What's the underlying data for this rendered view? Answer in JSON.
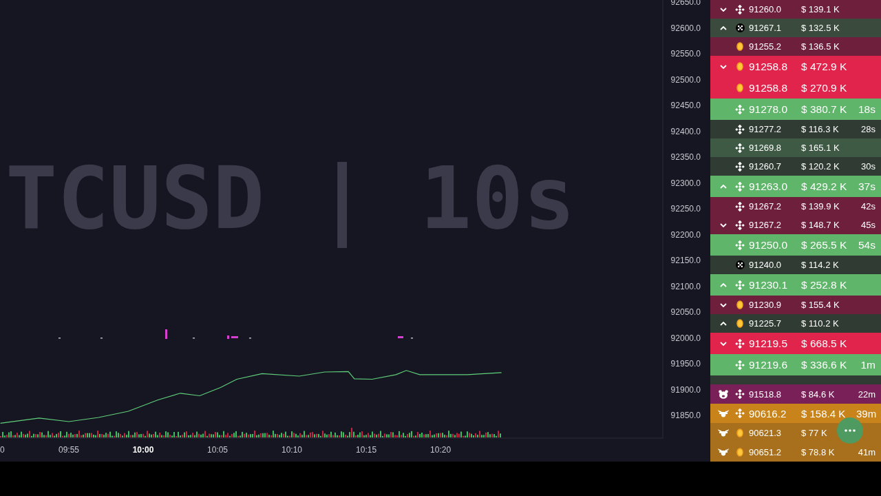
{
  "chart": {
    "watermark": "TCUSD | 10s",
    "cut_time_label": "0",
    "chart_data": {
      "type": "line",
      "x": [
        590.4,
        593,
        595,
        597,
        599,
        601,
        602.5,
        603.8,
        605.2,
        606.3,
        608,
        610.5,
        612.2,
        613.8,
        614.2,
        615.4,
        617,
        617.7,
        618.6,
        621.8,
        624.1
      ],
      "series": [
        {
          "color": "#5fd17a",
          "values": [
            91835,
            91845,
            91838,
            91846,
            91858,
            91880,
            91893,
            91888,
            91904,
            91920,
            91931,
            91926,
            91934,
            91935,
            91921,
            91920,
            91929,
            91937,
            91929,
            91929,
            91933
          ]
        }
      ],
      "xlim": [
        590.37,
        634.95
      ],
      "ylim": [
        91806,
        92654
      ],
      "xticks": [
        {
          "value": 595,
          "label": "09:55"
        },
        {
          "value": 600,
          "label": "10:00"
        },
        {
          "value": 605,
          "label": "10:05"
        },
        {
          "value": 610,
          "label": "10:10"
        },
        {
          "value": 615,
          "label": "10:15"
        },
        {
          "value": 620,
          "label": "10:20"
        }
      ],
      "yticks": [
        {
          "value": 92650,
          "label": "92650.0"
        },
        {
          "value": 92600,
          "label": "92600.0"
        },
        {
          "value": 92550,
          "label": "92550.0"
        },
        {
          "value": 92500,
          "label": "92500.0"
        },
        {
          "value": 92450,
          "label": "92450.0"
        },
        {
          "value": 92400,
          "label": "92400.0"
        },
        {
          "value": 92350,
          "label": "92350.0"
        },
        {
          "value": 92300,
          "label": "92300.0"
        },
        {
          "value": 92250,
          "label": "92250.0"
        },
        {
          "value": 92200,
          "label": "92200.0"
        },
        {
          "value": 92150,
          "label": "92150.0"
        },
        {
          "value": 92100,
          "label": "92100.0"
        },
        {
          "value": 92050,
          "label": "92050.0"
        },
        {
          "value": 92000,
          "label": "92000.0"
        },
        {
          "value": 91950,
          "label": "91950.0"
        },
        {
          "value": 91900,
          "label": "91900.0"
        },
        {
          "value": 91850,
          "label": "91850.0"
        }
      ]
    }
  },
  "trades": [
    {
      "up": false,
      "down": true,
      "kind": "diamond",
      "price": "91260.0",
      "amount": "$ 139.1 K",
      "color": "#6e1f3c",
      "large": false
    },
    {
      "up": true,
      "down": false,
      "kind": "cross",
      "price": "91267.1",
      "amount": "$ 132.5 K",
      "color": "#3a4a3c",
      "large": false
    },
    {
      "up": false,
      "down": false,
      "kind": "coin",
      "price": "91255.2",
      "amount": "$ 136.5 K",
      "color": "#6e1f3c",
      "large": false
    },
    {
      "up": false,
      "down": true,
      "kind": "coin",
      "price": "91258.8",
      "amount": "$ 472.9 K",
      "color": "#e0244c",
      "large": true
    },
    {
      "up": false,
      "down": false,
      "kind": "coin",
      "price": "91258.8",
      "amount": "$ 270.9 K",
      "color": "#e0244c",
      "large": true
    },
    {
      "up": false,
      "down": false,
      "kind": "diamond",
      "price": "91278.0",
      "amount": "$ 380.7 K",
      "age": "18s",
      "color": "#5fb56a",
      "large": true
    },
    {
      "up": false,
      "down": false,
      "kind": "diamond",
      "price": "91277.2",
      "amount": "$ 116.3 K",
      "age": "28s",
      "color": "#2f3b33",
      "large": false
    },
    {
      "up": false,
      "down": false,
      "kind": "diamond",
      "price": "91269.8",
      "amount": "$ 165.1 K",
      "color": "#3f5a44",
      "large": false
    },
    {
      "up": false,
      "down": false,
      "kind": "diamond",
      "price": "91260.7",
      "amount": "$ 120.2 K",
      "age": "30s",
      "color": "#2f3b33",
      "large": false
    },
    {
      "up": true,
      "down": false,
      "kind": "diamond",
      "price": "91263.0",
      "amount": "$ 429.2 K",
      "age": "37s",
      "color": "#5fb56a",
      "large": true
    },
    {
      "up": false,
      "down": false,
      "kind": "diamond",
      "price": "91267.2",
      "amount": "$ 139.9 K",
      "age": "42s",
      "color": "#6e1f3c",
      "large": false
    },
    {
      "up": false,
      "down": true,
      "kind": "diamond",
      "price": "91267.2",
      "amount": "$ 148.7 K",
      "age": "45s",
      "color": "#6e1f3c",
      "large": false
    },
    {
      "up": false,
      "down": false,
      "kind": "diamond",
      "price": "91250.0",
      "amount": "$ 265.5 K",
      "age": "54s",
      "color": "#5fb56a",
      "large": true
    },
    {
      "up": false,
      "down": false,
      "kind": "cross",
      "price": "91240.0",
      "amount": "$ 114.2 K",
      "color": "#2f3b33",
      "large": false
    },
    {
      "up": true,
      "down": false,
      "kind": "diamond",
      "price": "91230.1",
      "amount": "$ 252.8 K",
      "color": "#5fb56a",
      "large": true
    },
    {
      "up": false,
      "down": true,
      "kind": "coin",
      "price": "91230.9",
      "amount": "$ 155.4 K",
      "color": "#6e1f3c",
      "large": false
    },
    {
      "up": true,
      "down": false,
      "kind": "coin",
      "price": "91225.7",
      "amount": "$ 110.2 K",
      "color": "#2f3b33",
      "large": false
    },
    {
      "up": false,
      "down": true,
      "kind": "diamond",
      "price": "91219.5",
      "amount": "$ 668.5 K",
      "color": "#e0244c",
      "large": true
    },
    {
      "up": false,
      "down": false,
      "kind": "diamond",
      "price": "91219.6",
      "amount": "$ 336.6 K",
      "age": "1m",
      "color": "#5fb56a",
      "large": true
    }
  ],
  "whales": [
    {
      "bull": false,
      "kind": "diamond",
      "price": "91518.8",
      "amount": "$ 84.6 K",
      "age": "22m",
      "color": "#7a2058",
      "large": false
    },
    {
      "bull": true,
      "kind": "diamond",
      "price": "90616.2",
      "amount": "$ 158.4 K",
      "age": "39m",
      "color": "#c8841a",
      "large": true
    },
    {
      "bull": true,
      "kind": "coin",
      "price": "90621.3",
      "amount": "$ 77 K",
      "color": "#a8701c",
      "large": false
    },
    {
      "bull": true,
      "kind": "coin",
      "price": "90651.2",
      "amount": "$ 78.8 K",
      "age": "41m",
      "color": "#a8701c",
      "large": false
    }
  ]
}
